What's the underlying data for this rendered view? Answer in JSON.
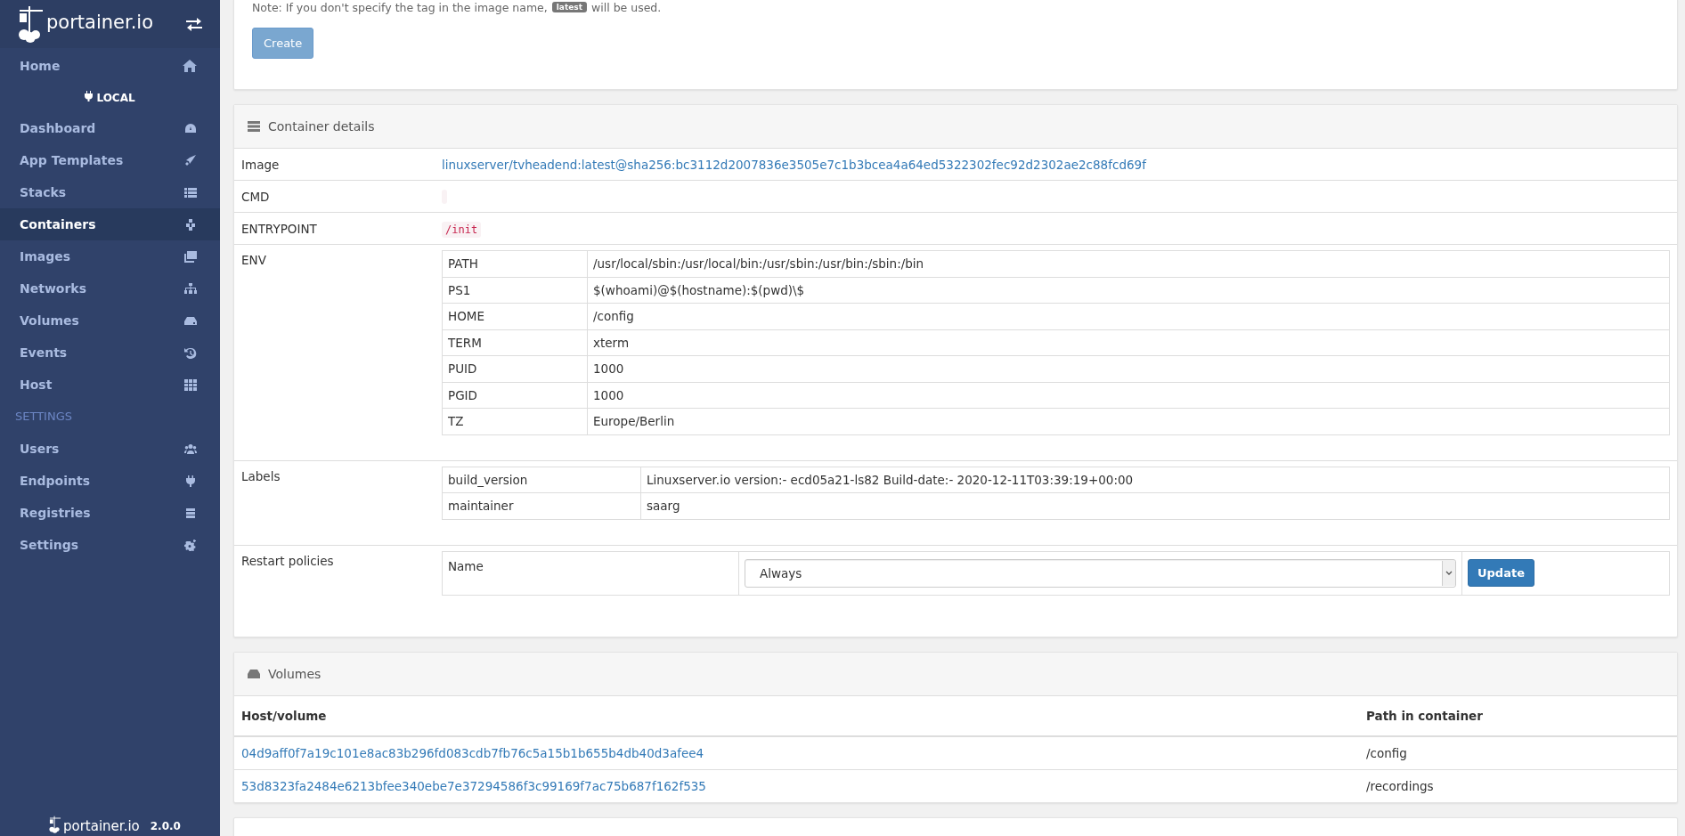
{
  "sidebar": {
    "logo": "portainer.io",
    "home": {
      "label": "Home",
      "selected": false
    },
    "endpoint": "LOCAL",
    "items": [
      {
        "label": "Dashboard",
        "selected": false
      },
      {
        "label": "App Templates",
        "selected": false
      },
      {
        "label": "Stacks",
        "selected": false
      },
      {
        "label": "Containers",
        "selected": true
      },
      {
        "label": "Images",
        "selected": false
      },
      {
        "label": "Networks",
        "selected": false
      },
      {
        "label": "Volumes",
        "selected": false
      },
      {
        "label": "Events",
        "selected": false
      },
      {
        "label": "Host",
        "selected": false
      }
    ],
    "section": "SETTINGS",
    "settings_items": [
      {
        "label": "Users",
        "selected": false
      },
      {
        "label": "Endpoints",
        "selected": false
      },
      {
        "label": "Registries",
        "selected": false
      },
      {
        "label": "Settings",
        "selected": false
      }
    ],
    "footer": {
      "logo": "portainer.io",
      "version": "2.0.0"
    }
  },
  "create_card": {
    "note_before": "Note: If you don't specify the tag in the image name,",
    "note_badge": "latest",
    "note_after": "will be used.",
    "create_button": {
      "label": "Create",
      "disabled": true
    }
  },
  "container_details": {
    "title": "Container details",
    "image": {
      "label": "Image",
      "value": "linuxserver/tvheadend:latest@sha256:bc3112d2007836e3505e7c1b3bcea4a64ed5322302fec92d2302ae2c88fcd69f"
    },
    "cmd": {
      "label": "CMD"
    },
    "entrypoint": {
      "label": "ENTRYPOINT",
      "value": "/init"
    },
    "env": {
      "label": "ENV",
      "rows": [
        {
          "key": "PATH",
          "value": "/usr/local/sbin:/usr/local/bin:/usr/sbin:/usr/bin:/sbin:/bin"
        },
        {
          "key": "PS1",
          "value": "$(whoami)@$(hostname):$(pwd)\\$"
        },
        {
          "key": "HOME",
          "value": "/config"
        },
        {
          "key": "TERM",
          "value": "xterm"
        },
        {
          "key": "PUID",
          "value": "1000"
        },
        {
          "key": "PGID",
          "value": "1000"
        },
        {
          "key": "TZ",
          "value": "Europe/Berlin"
        }
      ]
    },
    "labels": {
      "label": "Labels",
      "rows": [
        {
          "key": "build_version",
          "value": "Linuxserver.io version:- ecd05a21-ls82 Build-date:- 2020-12-11T03:39:19+00:00"
        },
        {
          "key": "maintainer",
          "value": "saarg"
        }
      ]
    },
    "restart_policies": {
      "label": "Restart policies",
      "name_label": "Name",
      "select_value": "Always",
      "update_button": "Update"
    }
  },
  "volumes": {
    "title": "Volumes",
    "columns": [
      "Host/volume",
      "Path in container"
    ],
    "rows": [
      {
        "host": "04d9aff0f7a19c101e8ac83b296fd083cdb7fb76c5a15b1b655b4db40d3afee4",
        "path": "/config"
      },
      {
        "host": "53d8323fa2484e6213bfee340ebe7e37294586f3c99169f7ac75b687f162f535",
        "path": "/recordings"
      }
    ]
  }
}
